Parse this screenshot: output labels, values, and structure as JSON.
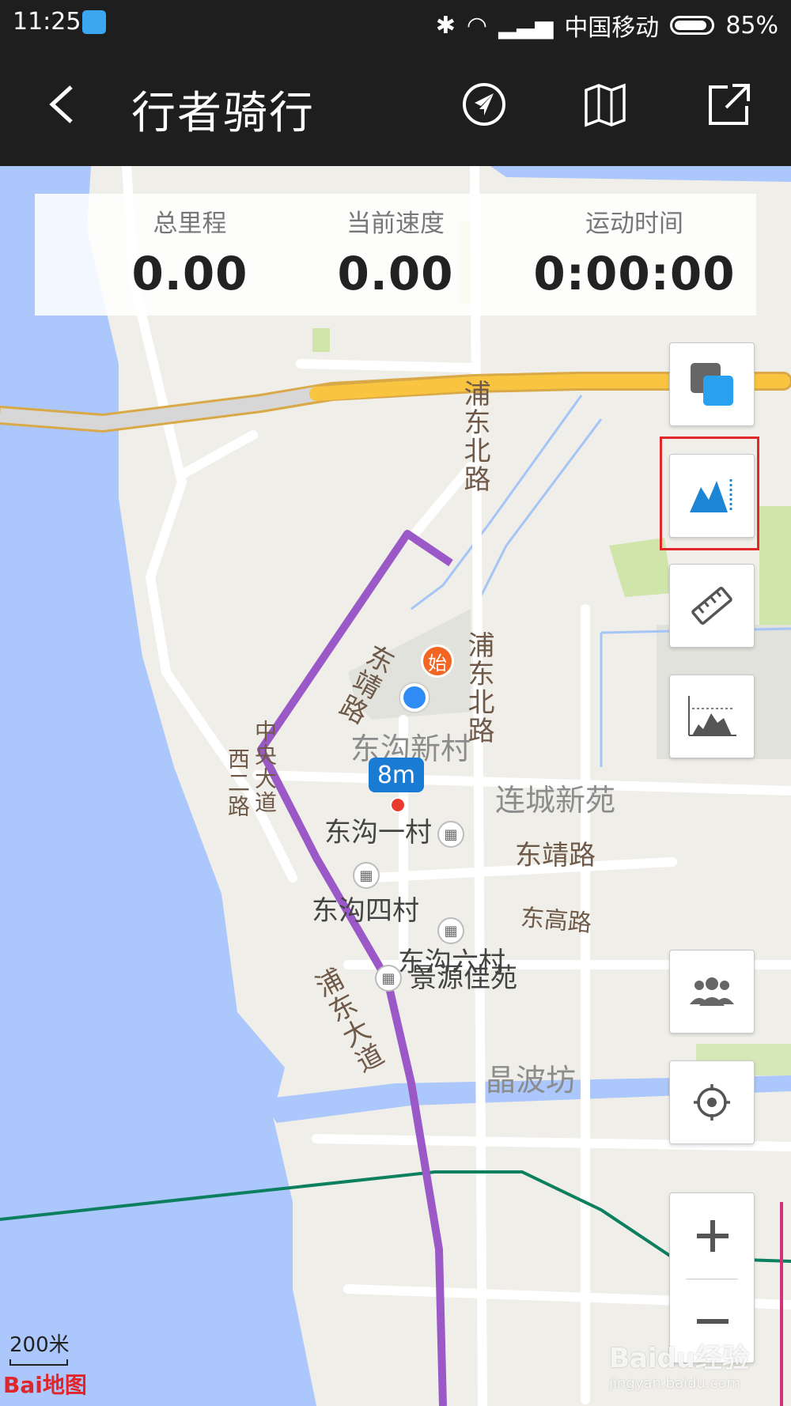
{
  "status_bar": {
    "time": "11:25",
    "carrier": "中国移动",
    "battery": "85%"
  },
  "app_bar": {
    "title": "行者骑行",
    "icons": [
      "back-icon",
      "navigate-icon",
      "map-icon",
      "share-icon"
    ]
  },
  "stats": {
    "distance_label": "总里程",
    "distance_value": "0.00",
    "speed_label": "当前速度",
    "speed_value": "0.00",
    "time_label": "运动时间",
    "time_value": "0:00:00"
  },
  "side_buttons": [
    "layers-icon",
    "elevation-icon",
    "ruler-icon",
    "chart-icon",
    "group-icon",
    "locate-icon"
  ],
  "zoom": {
    "in": "+",
    "out": "−"
  },
  "map": {
    "start_label": "始",
    "distance_badge": "8m",
    "labels": {
      "pudong_north_1": "浦东北路",
      "pudong_north_2": "浦东北路",
      "dongjing_rd_vertical": "东靖路",
      "zhongyang_1": "中央大道",
      "zhongyang_2": "西二路",
      "donggou_xincun": "东沟新村",
      "liancheng": "连城新苑",
      "donggou_1": "东沟一村",
      "dongjing_rd": "东靖路",
      "donggou_4": "东沟四村",
      "donggao_rd": "东高路",
      "donggou_6": "东沟六村",
      "jingyuan": "景源佳苑",
      "pudong_avenue": "浦东大道",
      "jingbofang": "晶波坊"
    },
    "scale": "200米",
    "logo": "Bai地图",
    "watermark_main": "Baidu经验",
    "watermark_sub": "jingyan.baidu.com"
  },
  "colors": {
    "route": "#9b59c8",
    "highlight": "#e3262a",
    "expressway": "#f9c440",
    "river": "#abc7fb"
  }
}
